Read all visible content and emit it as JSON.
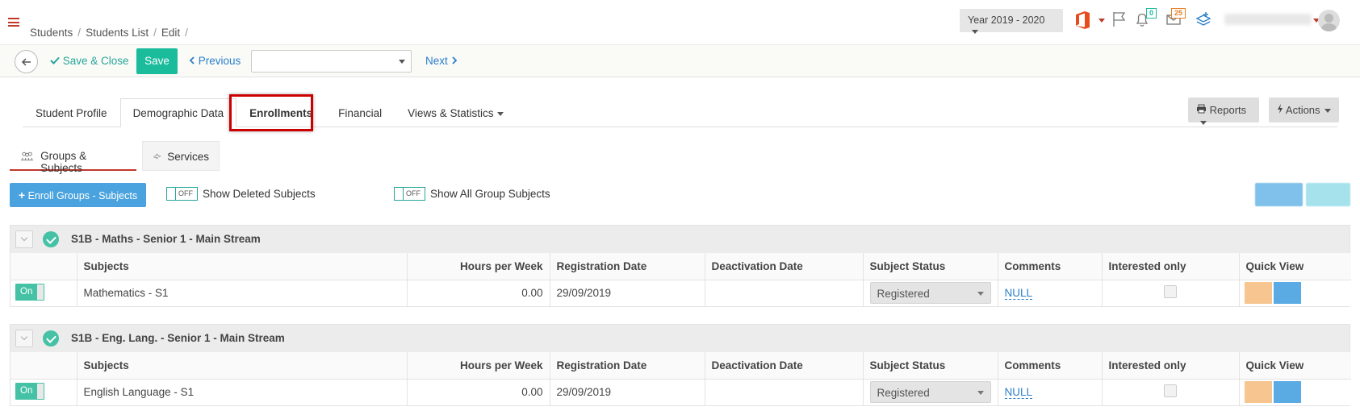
{
  "header": {
    "breadcrumb": [
      "Students",
      "Students List",
      "Edit"
    ],
    "year_label": "Year 2019 - 2020",
    "notif_count": "0",
    "messages_count": "25",
    "icons": [
      "hamburger-icon",
      "office-icon",
      "flag-icon",
      "bell-icon",
      "envelope-icon",
      "layers-icon",
      "avatar"
    ]
  },
  "toolbar": {
    "save_close": "Save & Close",
    "save": "Save",
    "previous": "Previous",
    "next": "Next",
    "select_value": ""
  },
  "tabs": [
    {
      "label": "Student Profile"
    },
    {
      "label": "Demographic Data"
    },
    {
      "label": "Enrollments"
    },
    {
      "label": "Financial"
    },
    {
      "label": "Views & Statistics"
    }
  ],
  "buttons": {
    "reports": "Reports",
    "actions": "Actions"
  },
  "subtabs": {
    "groups_subjects": "Groups & Subjects",
    "services": "Services"
  },
  "actions": {
    "enroll": "Enroll Groups - Subjects",
    "toggle_off": "OFF",
    "show_deleted": "Show Deleted Subjects",
    "show_all": "Show All Group Subjects"
  },
  "columns": [
    "Subjects",
    "Hours per Week",
    "Registration Date",
    "Deactivation Date",
    "Subject Status",
    "Comments",
    "Interested only",
    "Quick View"
  ],
  "groups": [
    {
      "title": "S1B - Maths - Senior 1 - Main Stream",
      "row": {
        "toggle": "On",
        "subject": "Mathematics - S1",
        "hours": "0.00",
        "registration": "29/09/2019",
        "deactivation": "",
        "status": "Registered",
        "comments": "NULL"
      }
    },
    {
      "title": "S1B - Eng. Lang. - Senior 1 - Main Stream",
      "row": {
        "toggle": "On",
        "subject": "English Language - S1",
        "hours": "0.00",
        "registration": "29/09/2019",
        "deactivation": "",
        "status": "Registered",
        "comments": "NULL"
      }
    }
  ],
  "colors": {
    "accent_green": "#1abc9c",
    "link_blue": "#2a7fc9",
    "highlight_red": "#cc0000",
    "enroll_blue": "#4aa3df"
  }
}
